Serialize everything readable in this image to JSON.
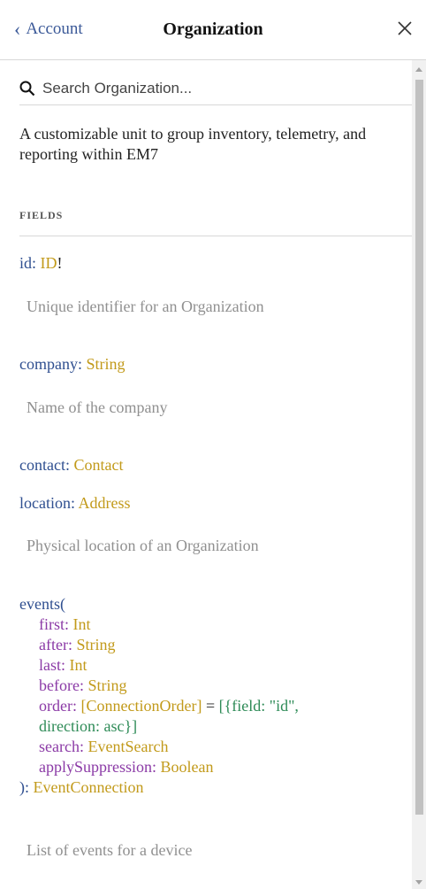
{
  "header": {
    "back_label": "Account",
    "title": "Organization"
  },
  "search": {
    "placeholder": "Search Organization..."
  },
  "description": "A customizable unit to group inventory, telemetry, and reporting within EM7",
  "section": {
    "title": "FIELDS"
  },
  "fields": {
    "id": {
      "name": "id",
      "type": "ID",
      "suffix": "!",
      "doc": "Unique identifier for an Organization"
    },
    "company": {
      "name": "company",
      "type": "String",
      "doc": "Name of the company"
    },
    "contact": {
      "name": "contact",
      "type": "Contact"
    },
    "location": {
      "name": "location",
      "type": "Address",
      "doc": "Physical location of an Organization"
    },
    "events": {
      "name": "events",
      "open": "(",
      "close": "):",
      "type": "EventConnection",
      "doc": "List of events for a device",
      "args": [
        {
          "name": "first",
          "type": "Int"
        },
        {
          "name": "after",
          "type": "String"
        },
        {
          "name": "last",
          "type": "Int"
        },
        {
          "name": "before",
          "type": "String"
        },
        {
          "name": "order",
          "type": "[ConnectionOrder]",
          "default": "[{field: \"id\", direction: asc}]",
          "default_line1": "[{field: \"id\",",
          "default_line2": "direction: asc}]"
        },
        {
          "name": "search",
          "type": "EventSearch"
        },
        {
          "name": "applySuppression",
          "type": "Boolean"
        }
      ]
    }
  },
  "colors": {
    "field_name": "#2f4f90",
    "type": "#c29a1a",
    "arg_name": "#8b3aa6",
    "default_value": "#2e8b57",
    "doc": "#909090"
  }
}
